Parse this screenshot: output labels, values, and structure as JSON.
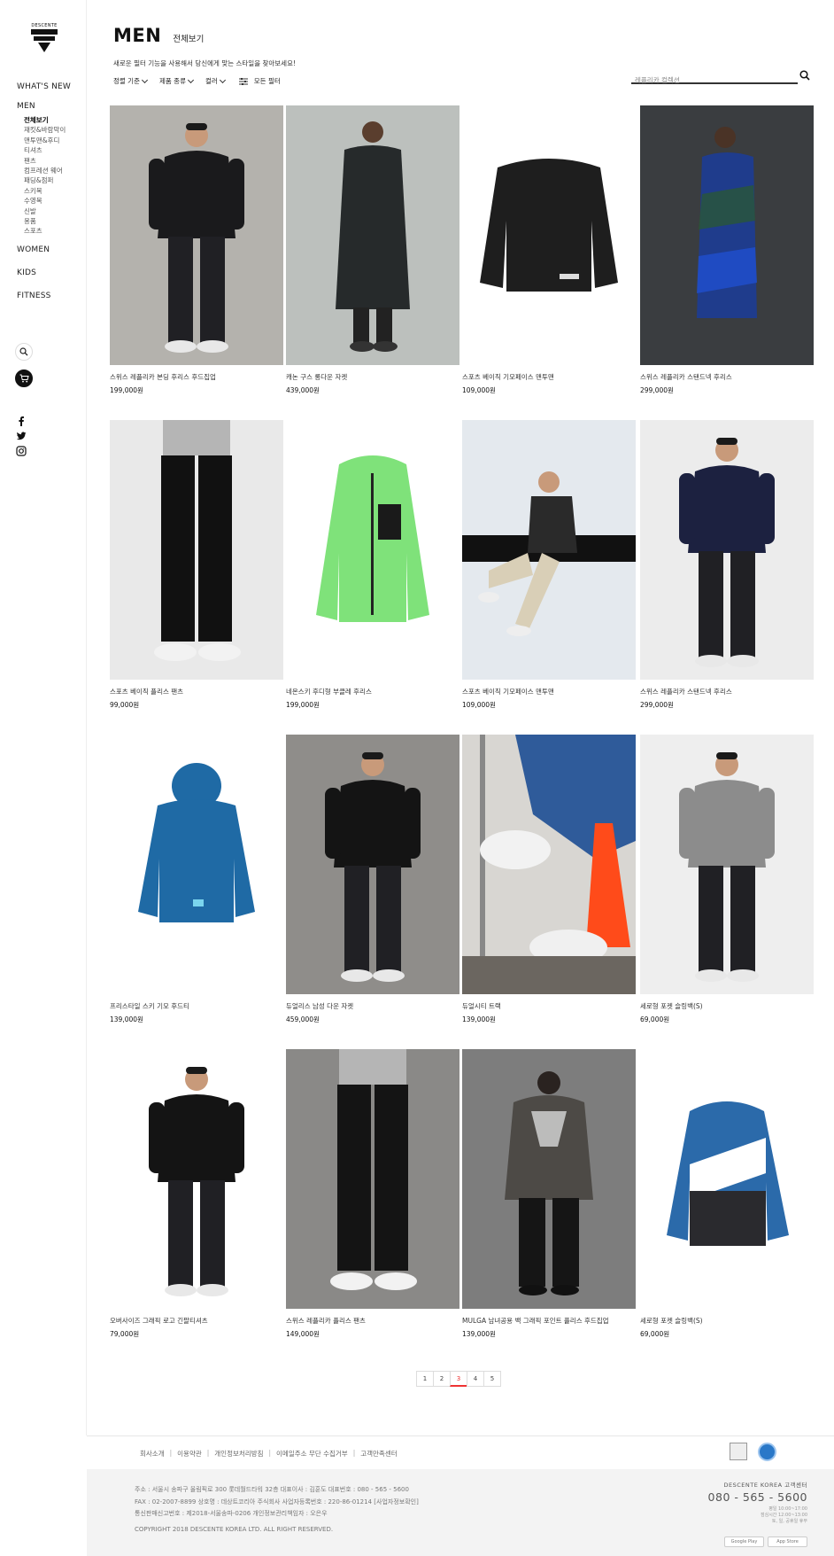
{
  "brand": {
    "logo_text": "DESCENTE"
  },
  "sidebar": {
    "nav": {
      "whats_new": "WHAT'S NEW",
      "men": "MEN",
      "women": "WOMEN",
      "kids": "KIDS",
      "fitness": "FITNESS"
    },
    "men_sub": [
      "전체보기",
      "재킷&바람막이",
      "맨투맨&후디",
      "티셔츠",
      "팬츠",
      "컴프레션 웨어",
      "패딩&점퍼",
      "스키복",
      "수영복",
      "신발",
      "용품",
      "스포츠"
    ],
    "active_sub": "전체보기"
  },
  "header": {
    "title": "MEN",
    "subtitle": "전체보기",
    "filter_hint": "새로운 필터 기능을 사용해서 당신에게 맞는 스타일을 찾아보세요!",
    "filters": [
      "정렬 기준",
      "제품 종류",
      "컬러"
    ],
    "all_filters": "모든 필터",
    "search_placeholder": "레플리카 컬렉션"
  },
  "products": [
    {
      "name": "스위스 레플리카 본딩 후리스 후드집업",
      "price": "199,000원",
      "bg": "#b4b2ad",
      "garment": "#1a1a1c",
      "type": "model"
    },
    {
      "name": "캐논 구스 롱다운 자켓",
      "price": "439,000원",
      "bg": "#bcc0bd",
      "garment": "#262a2b",
      "type": "longcoat"
    },
    {
      "name": "스포츠 베이직 기모페이스 맨투맨",
      "price": "109,000원",
      "bg": "#ffffff",
      "garment": "#1e1e1e",
      "type": "flatshirt"
    },
    {
      "name": "스위스 레플리카 스탠드넥 후리스",
      "price": "299,000원",
      "bg": "#3a3d40",
      "garment": "#1f3c8c",
      "type": "side"
    },
    {
      "name": "스포츠 베이직 플리스 팬츠",
      "price": "99,000원",
      "bg": "#e9e9e9",
      "garment": "#111111",
      "type": "pants"
    },
    {
      "name": "네온스키 후디형 부클레 후리스",
      "price": "199,000원",
      "bg": "#ffffff",
      "garment": "#7fe27a",
      "type": "flatjacket"
    },
    {
      "name": "스포츠 베이직 기모페이스 맨투맨",
      "price": "109,000원",
      "bg": "#e4e9ee",
      "garment": "#2a2a2a",
      "type": "sitting"
    },
    {
      "name": "스위스 레플리카 스탠드넥 후리스",
      "price": "299,000원",
      "bg": "#ececec",
      "garment": "#1c2140",
      "type": "model"
    },
    {
      "name": "프리스타일 스키 기모 후드티",
      "price": "139,000원",
      "bg": "#ffffff",
      "garment": "#1f6aa5",
      "type": "flathoodie"
    },
    {
      "name": "듀얼리스 남성 다운 자켓",
      "price": "459,000원",
      "bg": "#8f8d8a",
      "garment": "#141414",
      "type": "model"
    },
    {
      "name": "듀얼시티 트랙",
      "price": "139,000원",
      "bg": "#d8d6d2",
      "garment": "#2f5b9a",
      "type": "shoes"
    },
    {
      "name": "세로형 포켓 슬링백(S)",
      "price": "69,000원",
      "bg": "#eeeeee",
      "garment": "#8c8c8c",
      "type": "model"
    },
    {
      "name": "오버사이즈 그래픽 로고 긴팔티셔츠",
      "price": "79,000원",
      "bg": "#ffffff",
      "garment": "#141414",
      "type": "model"
    },
    {
      "name": "스위스 레플리카 플리스 팬츠",
      "price": "149,000원",
      "bg": "#8a8987",
      "garment": "#141414",
      "type": "pants"
    },
    {
      "name": "MULGA 남녀공용 백 그래픽 포인트 플리스 후드집업",
      "price": "139,000원",
      "bg": "#7d7d7d",
      "garment": "#4d4a46",
      "type": "back"
    },
    {
      "name": "세로형 포켓 슬링백(S)",
      "price": "69,000원",
      "bg": "#ffffff",
      "garment": "#2b6aaa",
      "type": "flatjacket2"
    }
  ],
  "pagination": {
    "pages": [
      "1",
      "2",
      "3",
      "4",
      "5"
    ],
    "active": "3"
  },
  "footer": {
    "links": [
      "회사소개",
      "이용약관",
      "개인정보처리방침",
      "이메일주소 무단 수집거부",
      "고객만족센터"
    ],
    "address_lines": [
      "주소 : 서울시 송파구 올림픽로 300 롯데월드타워 32층 대표이사 : 김훈도 대표번호 : 080 - 565 - 5600",
      "FAX : 02-2007-8899 상호명 : 데상트코리아 주식회사 사업자등록번호 : 220-86-01214 [사업자정보확인]",
      "통신판매신고번호 : 제2018-서울송파-0206 개인정보관리책임자 : 오은우"
    ],
    "copyright": "COPYRIGHT 2018 DESCENTE KOREA LTD. ALL RIGHT RESERVED.",
    "cs_title": "DESCENTE KOREA 고객센터",
    "cs_phone": "080 - 565 - 5600",
    "cs_hours": [
      "평일 10:00~17:00",
      "점심시간 12:00~13:00",
      "토, 일, 공휴일 휴무"
    ],
    "google_play": "Google Play",
    "app_store": "App Store"
  }
}
